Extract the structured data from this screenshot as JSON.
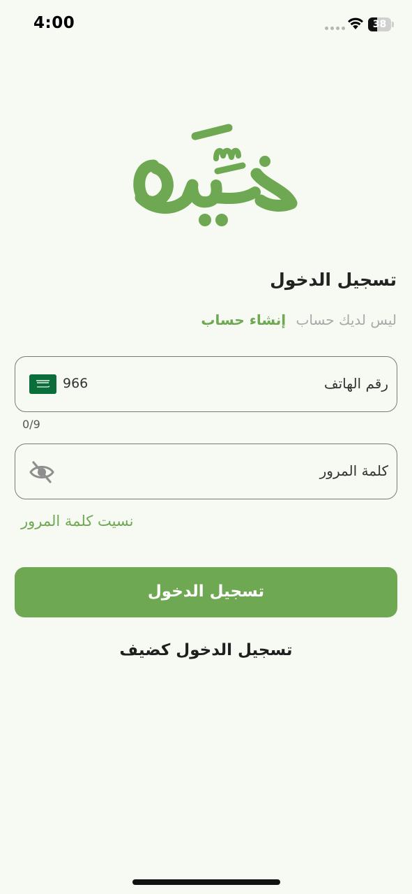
{
  "status_bar": {
    "time": "4:00",
    "battery_level": 38
  },
  "brand": {
    "logo_text": "هَيِّن",
    "accent_color": "#6fa852"
  },
  "login": {
    "title": "تسجيل الدخول",
    "signup_prompt": "ليس لديك حساب",
    "signup_link": "إنشاء حساب",
    "phone": {
      "label": "رقم الهاتف",
      "country_code": "966",
      "flag": "saudi-arabia-flag-icon",
      "counter": "0/9"
    },
    "password": {
      "label": "كلمة المرور",
      "toggle_icon": "eye-off-icon"
    },
    "forgot_password": "نسيت كلمة المرور",
    "submit_label": "تسجيل الدخول",
    "guest_label": "تسجيل الدخول كضيف"
  }
}
